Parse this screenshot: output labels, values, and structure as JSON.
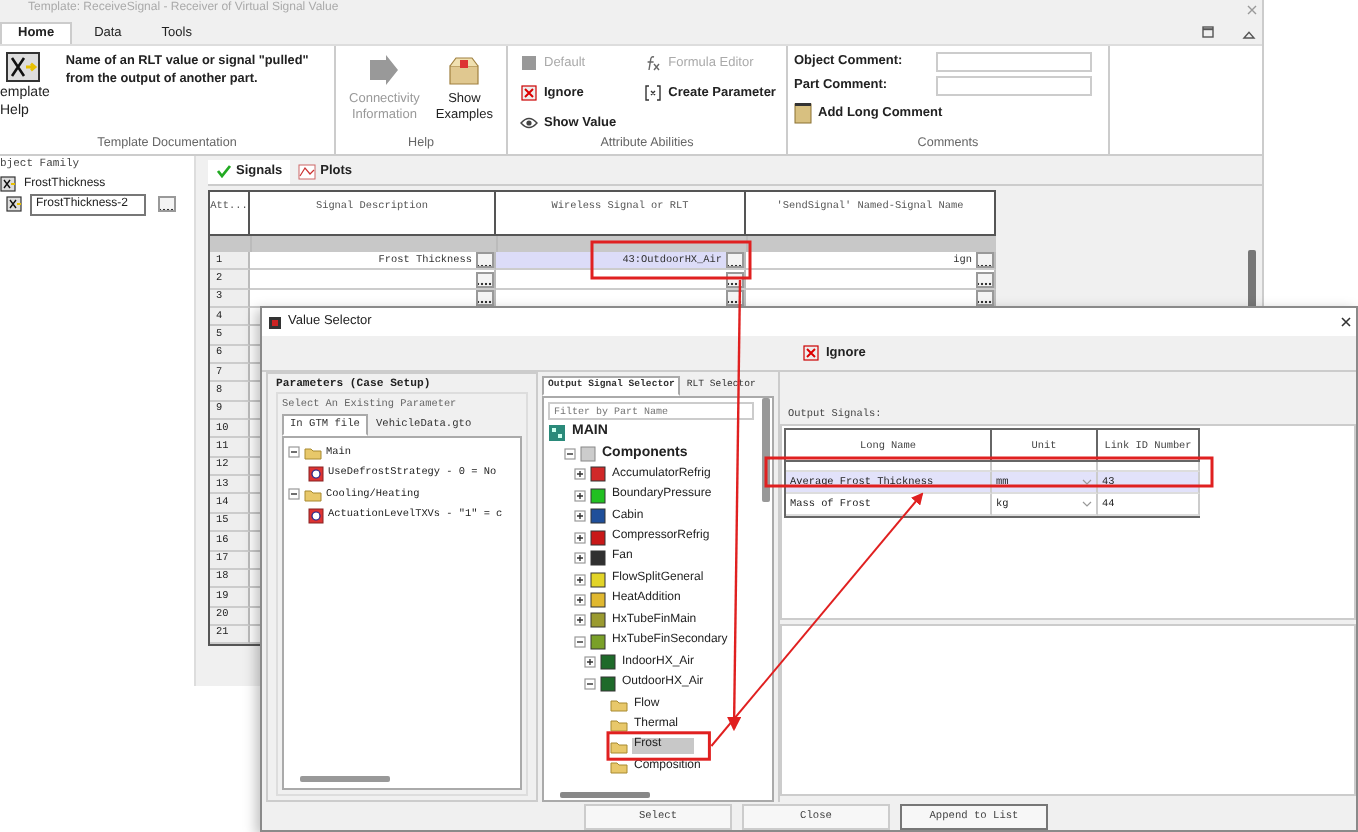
{
  "window": {
    "title": "Template: ReceiveSignal - Receiver of Virtual Signal Value"
  },
  "ribbon_tabs": [
    {
      "label": "Home",
      "selected": true
    },
    {
      "label": "Data",
      "selected": false
    },
    {
      "label": "Tools",
      "selected": false
    }
  ],
  "ribbon_groups": [
    {
      "kind": "doc",
      "label": "Template Documentation",
      "button_lines": [
        "emplate",
        "Help"
      ],
      "description": "Name of an RLT value or signal \"pulled\" from the output of another part."
    },
    {
      "kind": "large",
      "label": "Help",
      "buttons": [
        {
          "text": "Connectivity Information",
          "disabled": true
        },
        {
          "text": "Show Examples",
          "disabled": false
        }
      ]
    },
    {
      "kind": "small",
      "label": "Attribute Abilities",
      "buttons": [
        {
          "text": "Default",
          "disabled": true
        },
        {
          "text": "Ignore",
          "disabled": false
        },
        {
          "text": "Show Value",
          "disabled": false
        },
        {
          "text": "Formula Editor",
          "disabled": true
        },
        {
          "text": "Create Parameter",
          "disabled": false
        }
      ]
    },
    {
      "kind": "comments",
      "label": "Comments",
      "fields": [
        {
          "label": "Object Comment:"
        },
        {
          "label": "Part Comment:"
        }
      ],
      "button": "Add Long Comment"
    }
  ],
  "family": {
    "title": "bject Family",
    "items": [
      {
        "label": "FrostThickness",
        "selected": false,
        "children": [
          {
            "label": "FrostThickness-2",
            "selected": true
          }
        ]
      }
    ]
  },
  "main_tabs": [
    {
      "label": "Signals",
      "selected": true
    },
    {
      "label": "Plots",
      "selected": false
    }
  ],
  "grid": {
    "columns": [
      "Att...",
      "Signal Description",
      "Wireless Signal or RLT",
      "'SendSignal' Named-Signal Name"
    ],
    "rows": [
      {
        "number": "1",
        "description": "Frost Thickness",
        "signal": "43:OutdoorHX_Air",
        "send_name": "ign",
        "selected": true
      },
      {
        "number": "2",
        "selected": false
      },
      {
        "number": "3",
        "selected": false
      },
      {
        "number": "4"
      },
      {
        "number": "5"
      },
      {
        "number": "6"
      },
      {
        "number": "7"
      },
      {
        "number": "8"
      },
      {
        "number": "9"
      },
      {
        "number": "10"
      },
      {
        "number": "11"
      },
      {
        "number": "12"
      },
      {
        "number": "13"
      },
      {
        "number": "14"
      },
      {
        "number": "15"
      },
      {
        "number": "16"
      },
      {
        "number": "17"
      },
      {
        "number": "18"
      },
      {
        "number": "19"
      },
      {
        "number": "20"
      },
      {
        "number": "21"
      }
    ]
  },
  "dialog": {
    "title": "Value Selector",
    "toolbar": [
      {
        "text": "Ignore"
      }
    ],
    "parameters": {
      "title": "Parameters (Case Setup)",
      "group": "Select An Existing Parameter",
      "tabs": [
        {
          "label": "In GTM file",
          "selected": true
        },
        {
          "label": "VehicleData.gto",
          "selected": false
        }
      ],
      "tree": [
        {
          "label": "Main",
          "expanded": true,
          "children": [
            {
              "label": "UseDefrostStrategy - 0 = No"
            }
          ]
        },
        {
          "label": "Cooling/Heating",
          "expanded": true,
          "children": [
            {
              "label": "ActuationLevelTXVs - \"1\" = c"
            }
          ]
        }
      ]
    },
    "selector": {
      "tabs": [
        {
          "label": "Output Signal Selector",
          "selected": true
        },
        {
          "label": "RLT Selector",
          "selected": false
        }
      ],
      "filter": {
        "placeholder": "Filter by Part Name"
      },
      "tree": [
        {
          "label": "MAIN",
          "kind": "root",
          "selected": false,
          "children": [
            {
              "label": "Components",
              "kind": "group",
              "expanded": true,
              "selected": false,
              "children": [
                {
                  "label": "AccumulatorRefrig",
                  "kind": "part",
                  "color": "#d02828",
                  "expanded": false,
                  "selected": false
                },
                {
                  "label": "BoundaryPressure",
                  "kind": "part",
                  "color": "#22c022",
                  "expanded": false,
                  "selected": false
                },
                {
                  "label": "Cabin",
                  "kind": "part",
                  "color": "#1f4f9a",
                  "expanded": false,
                  "selected": false
                },
                {
                  "label": "CompressorRefrig",
                  "kind": "part",
                  "color": "#c81818",
                  "expanded": false,
                  "selected": false
                },
                {
                  "label": "Fan",
                  "kind": "part",
                  "color": "#303030",
                  "expanded": false,
                  "selected": false
                },
                {
                  "label": "FlowSplitGeneral",
                  "kind": "part",
                  "color": "#e2d428",
                  "expanded": false,
                  "selected": false
                },
                {
                  "label": "HeatAddition",
                  "kind": "part",
                  "color": "#e0b830",
                  "expanded": false,
                  "selected": false
                },
                {
                  "label": "HxTubeFinMain",
                  "kind": "part",
                  "color": "#9a9a30",
                  "expanded": false,
                  "selected": false
                },
                {
                  "label": "HxTubeFinSecondary",
                  "kind": "part",
                  "color": "#7aa028",
                  "expanded": true,
                  "selected": false,
                  "children": [
                    {
                      "label": "IndoorHX_Air",
                      "kind": "part",
                      "color": "#1e6a2a",
                      "expanded": false,
                      "selected": false
                    },
                    {
                      "label": "OutdoorHX_Air",
                      "kind": "part",
                      "color": "#1e6a2a",
                      "expanded": true,
                      "selected": false,
                      "children": [
                        {
                          "label": "Flow",
                          "kind": "folder",
                          "selected": false
                        },
                        {
                          "label": "Thermal",
                          "kind": "folder",
                          "selected": false
                        },
                        {
                          "label": "Frost",
                          "kind": "folder",
                          "selected": true
                        },
                        {
                          "label": "Composition",
                          "kind": "folder",
                          "selected": false
                        }
                      ]
                    }
                  ]
                }
              ]
            }
          ]
        }
      ]
    },
    "output": {
      "title": "Output Signals:",
      "columns": [
        "Long Name",
        "Unit",
        "Link ID Number"
      ],
      "rows": [
        {
          "long_name": "Average Frost Thickness",
          "unit": "mm",
          "link_id": "43",
          "selected": true
        },
        {
          "long_name": "Mass of Frost",
          "unit": "kg",
          "link_id": "44",
          "selected": false
        }
      ]
    },
    "buttons": [
      {
        "label": "Select",
        "default": false
      },
      {
        "label": "Close",
        "default": false
      },
      {
        "label": "Append to List",
        "default": true
      }
    ]
  }
}
